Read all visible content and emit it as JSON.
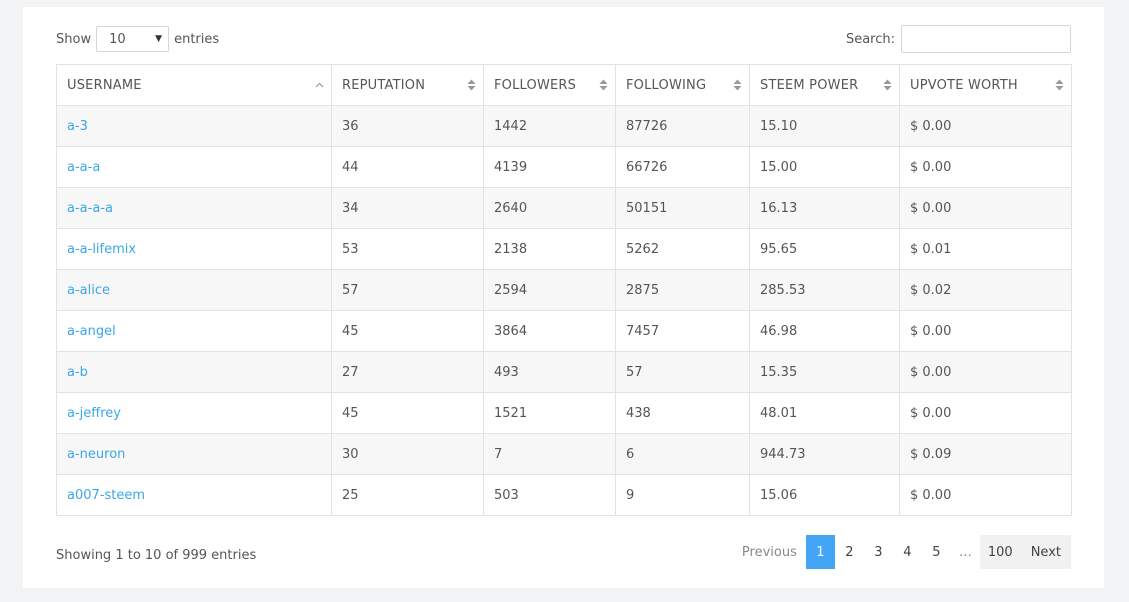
{
  "length_menu": {
    "show_label": "Show",
    "selected": "10",
    "entries_label": "entries"
  },
  "search": {
    "label": "Search:",
    "value": "",
    "placeholder": ""
  },
  "table": {
    "columns": [
      "USERNAME",
      "REPUTATION",
      "FOLLOWERS",
      "FOLLOWING",
      "STEEM POWER",
      "UPVOTE WORTH"
    ],
    "rows": [
      [
        "a-3",
        "36",
        "1442",
        "87726",
        "15.10",
        "$ 0.00"
      ],
      [
        "a-a-a",
        "44",
        "4139",
        "66726",
        "15.00",
        "$ 0.00"
      ],
      [
        "a-a-a-a",
        "34",
        "2640",
        "50151",
        "16.13",
        "$ 0.00"
      ],
      [
        "a-a-lifemix",
        "53",
        "2138",
        "5262",
        "95.65",
        "$ 0.01"
      ],
      [
        "a-alice",
        "57",
        "2594",
        "2875",
        "285.53",
        "$ 0.02"
      ],
      [
        "a-angel",
        "45",
        "3864",
        "7457",
        "46.98",
        "$ 0.00"
      ],
      [
        "a-b",
        "27",
        "493",
        "57",
        "15.35",
        "$ 0.00"
      ],
      [
        "a-jeffrey",
        "45",
        "1521",
        "438",
        "48.01",
        "$ 0.00"
      ],
      [
        "a-neuron",
        "30",
        "7",
        "6",
        "944.73",
        "$ 0.09"
      ],
      [
        "a007-steem",
        "25",
        "503",
        "9",
        "15.06",
        "$ 0.00"
      ]
    ]
  },
  "info_text": "Showing 1 to 10 of 999 entries",
  "pagination": {
    "previous": "Previous",
    "pages": [
      "1",
      "2",
      "3",
      "4",
      "5"
    ],
    "ellipsis": "…",
    "last": "100",
    "next": "Next",
    "active": "1"
  },
  "colors": {
    "link": "#3aa7e6",
    "active_page": "#42a5f5"
  },
  "icons": {
    "select_caret": "caret-down-icon",
    "sort_asc": "sort-ascending-icon",
    "sort_both": "sort-both-icon"
  }
}
